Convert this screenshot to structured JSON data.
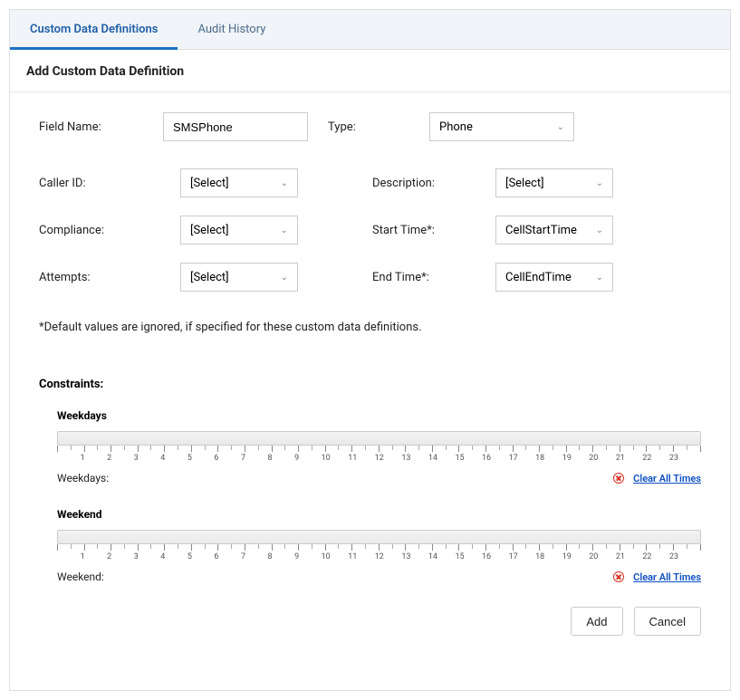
{
  "tabs": {
    "custom_data_definitions": "Custom Data Definitions",
    "audit_history": "Audit History"
  },
  "section_title": "Add Custom Data Definition",
  "form": {
    "field_name_label": "Field Name:",
    "field_name_value": "SMSPhone",
    "type_label": "Type:",
    "type_value": "Phone",
    "caller_id_label": "Caller ID:",
    "caller_id_value": "[Select]",
    "description_label": "Description:",
    "description_value": "[Select]",
    "compliance_label": "Compliance:",
    "compliance_value": "[Select]",
    "start_time_label": "Start Time*:",
    "start_time_value": "CellStartTime",
    "attempts_label": "Attempts:",
    "attempts_value": "[Select]",
    "end_time_label": "End Time*:",
    "end_time_value": "CellEndTime"
  },
  "note": "*Default values are ignored, if specified for these custom data definitions.",
  "constraints": {
    "title": "Constraints:",
    "weekdays": {
      "title": "Weekdays",
      "footer_label": "Weekdays:",
      "clear_label": "Clear All Times"
    },
    "weekend": {
      "title": "Weekend",
      "footer_label": "Weekend:",
      "clear_label": "Clear All Times"
    },
    "hours": [
      "1",
      "2",
      "3",
      "4",
      "5",
      "6",
      "7",
      "8",
      "9",
      "10",
      "11",
      "12",
      "13",
      "14",
      "15",
      "16",
      "17",
      "18",
      "19",
      "20",
      "21",
      "22",
      "23"
    ]
  },
  "actions": {
    "add": "Add",
    "cancel": "Cancel"
  }
}
